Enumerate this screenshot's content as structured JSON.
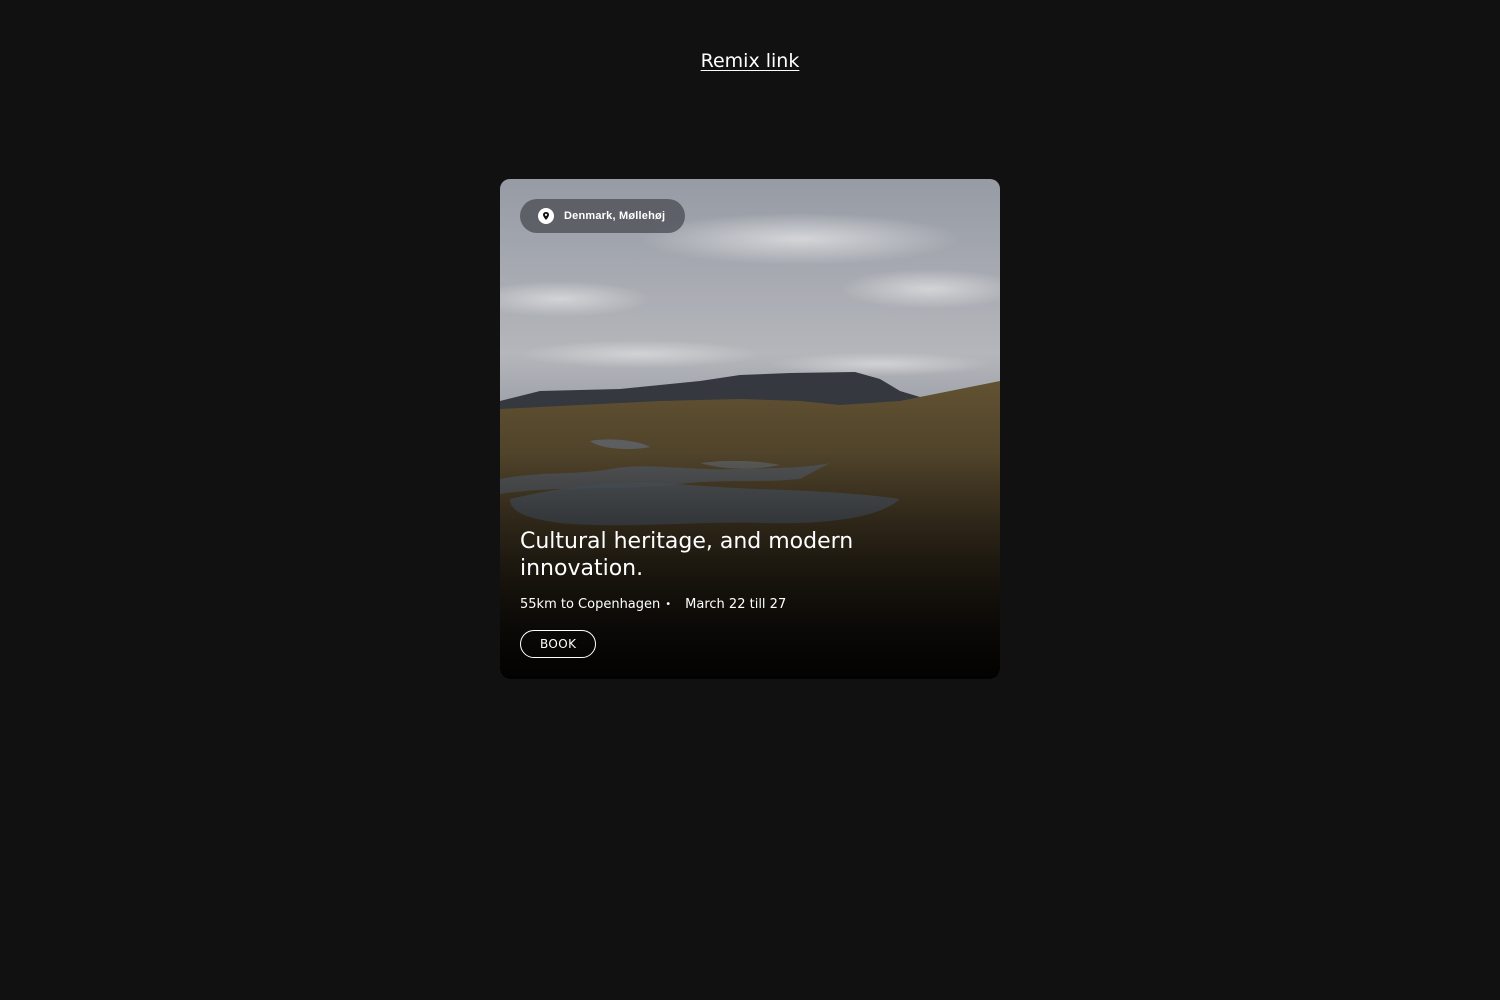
{
  "header": {
    "remix_link_label": "Remix link "
  },
  "card": {
    "location": {
      "icon": "location-pin-icon",
      "label": "Denmark, Møllehøj"
    },
    "title": "Cultural heritage, and modern innovation.",
    "distance": "55km to Copenhagen",
    "separator": "•",
    "dates": "March 22 till 27",
    "book_label": "BOOK"
  },
  "colors": {
    "background": "#111111",
    "text": "#ffffff",
    "pill_background": "#4b4e54"
  }
}
